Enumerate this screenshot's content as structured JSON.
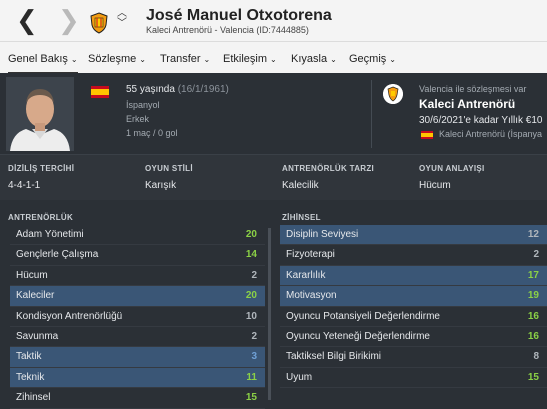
{
  "header": {
    "name": "José Manuel Otxotorena",
    "subtitle": "Kaleci Antrenörü - Valencia (ID:7444885)",
    "back_icon": "chevron-left-icon",
    "forward_icon": "chevron-right-icon",
    "club_icon": "valencia-crest-icon",
    "updown_icon": "chevron-up-down-icon"
  },
  "tabs": [
    {
      "label": "Genel Bakış"
    },
    {
      "label": "Sözleşme"
    },
    {
      "label": "Transfer"
    },
    {
      "label": "Etkileşim"
    },
    {
      "label": "Kıyasla"
    },
    {
      "label": "Geçmiş"
    }
  ],
  "profile": {
    "age": "55 yaşında",
    "dob": "(16/1/1961)",
    "nationality": "İspanyol",
    "gender": "Erkek",
    "record": "1 maç / 0 gol"
  },
  "contract": {
    "label": "Valencia ile sözleşmesi var",
    "role": "Kaleci Antrenörü",
    "detail": "30/6/2021'e kadar Yıllık €10",
    "role_row": "Kaleci Antrenörü (İspanya"
  },
  "prefs": [
    {
      "header": "DİZİLİŞ TERCİHİ",
      "value": "4-4-1-1"
    },
    {
      "header": "OYUN STİLİ",
      "value": "Karışık"
    },
    {
      "header": "ANTRENÖRLÜK TARZI",
      "value": "Kalecilik"
    },
    {
      "header": "OYUN ANLAYIŞI",
      "value": "Hücum"
    }
  ],
  "coaching": {
    "title": "ANTRENÖRLÜK",
    "attrs": [
      {
        "label": "Adam Yönetimi",
        "value": "20"
      },
      {
        "label": "Gençlerle Çalışma",
        "value": "14"
      },
      {
        "label": "Hücum",
        "value": "2"
      },
      {
        "label": "Kaleciler",
        "value": "20"
      },
      {
        "label": "Kondisyon Antrenörlüğü",
        "value": "10"
      },
      {
        "label": "Savunma",
        "value": "2"
      },
      {
        "label": "Taktik",
        "value": "3"
      },
      {
        "label": "Teknik",
        "value": "11"
      },
      {
        "label": "Zihinsel",
        "value": "15"
      }
    ]
  },
  "mental": {
    "title": "ZİHİNSEL",
    "attrs": [
      {
        "label": "Disiplin Seviyesi",
        "value": "12"
      },
      {
        "label": "Fizyoterapi",
        "value": "2"
      },
      {
        "label": "Kararlılık",
        "value": "17"
      },
      {
        "label": "Motivasyon",
        "value": "19"
      },
      {
        "label": "Oyuncu Potansiyeli Değerlendirme",
        "value": "16"
      },
      {
        "label": "Oyuncu Yeteneği Değerlendirme",
        "value": "16"
      },
      {
        "label": "Taktiksel Bilgi Birikimi",
        "value": "8"
      },
      {
        "label": "Uyum",
        "value": "15"
      }
    ]
  }
}
